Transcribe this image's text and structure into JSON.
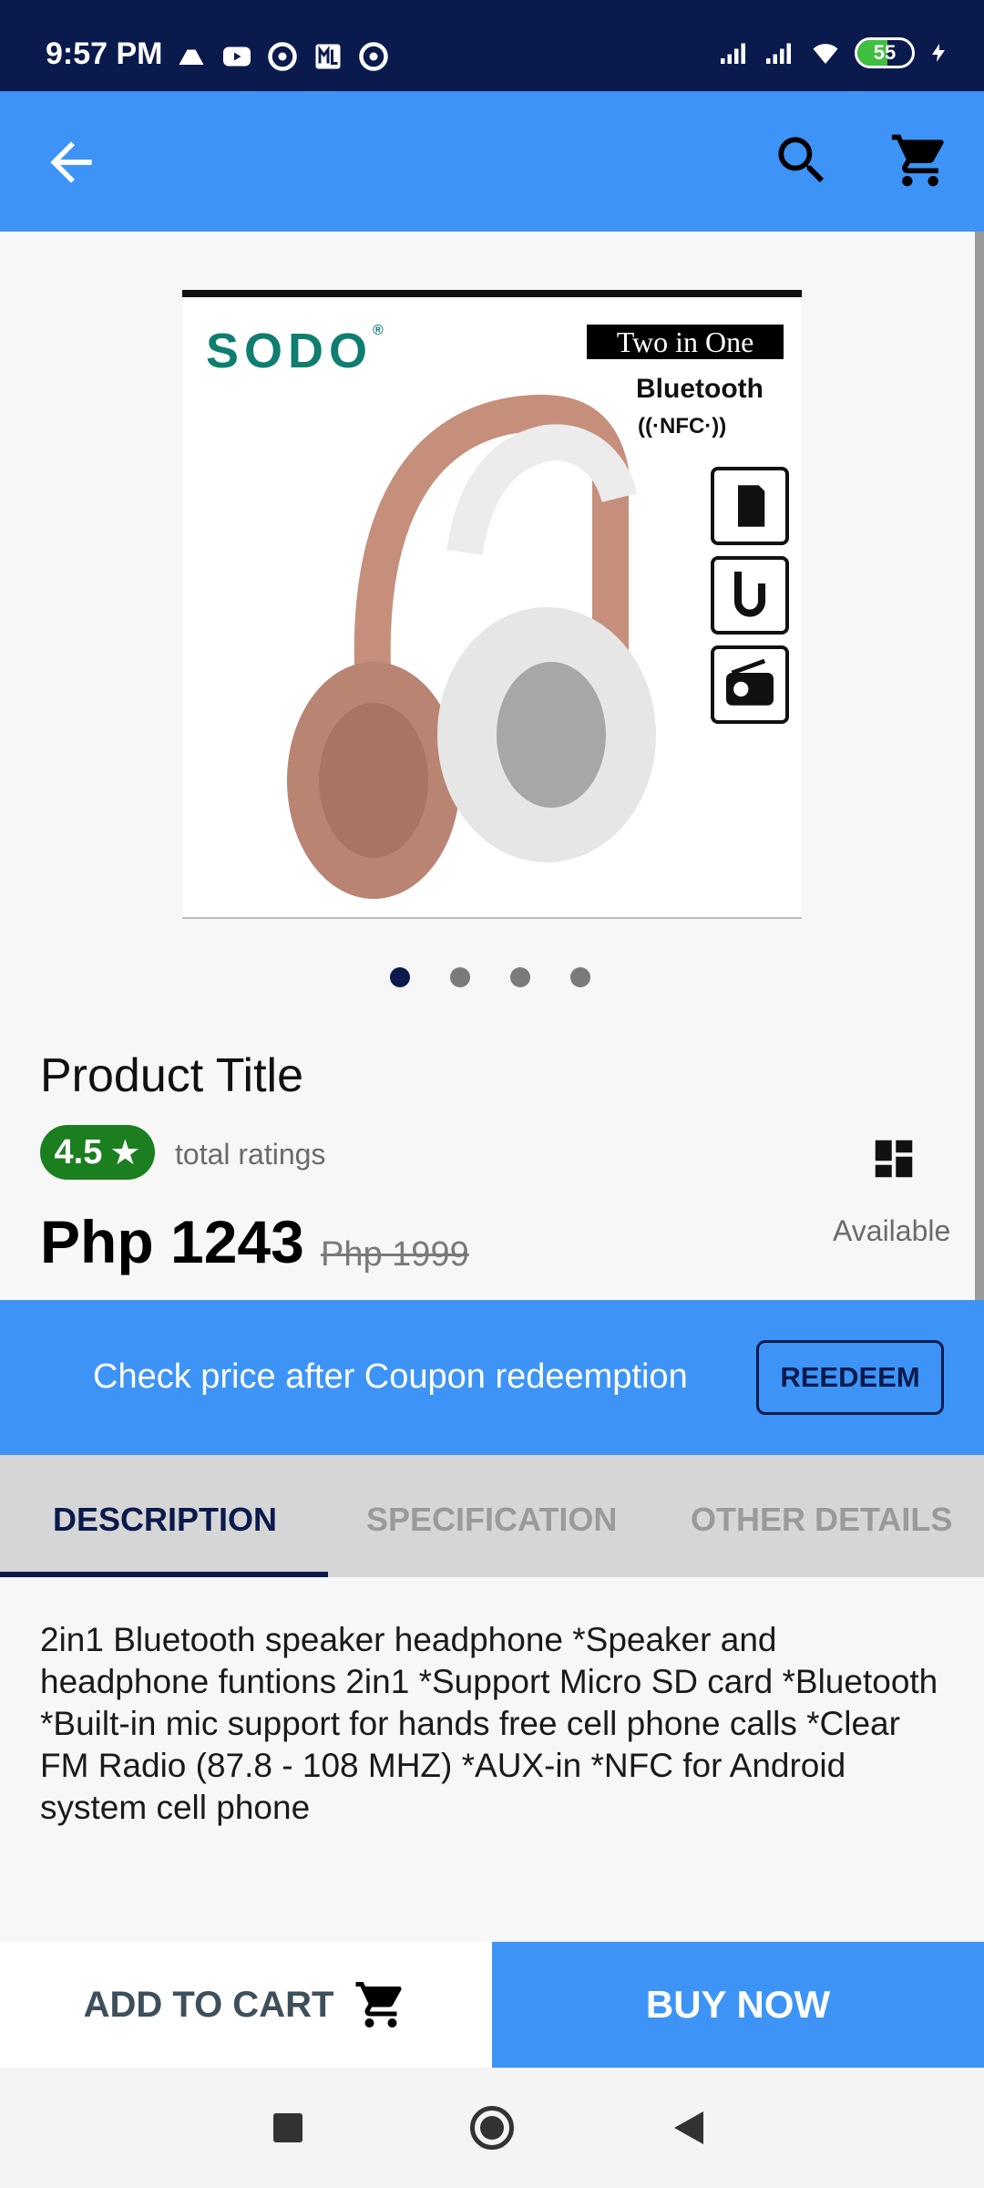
{
  "status_bar": {
    "time": "9:57 PM",
    "battery_level": "55",
    "icons": [
      "drive-icon",
      "youtube-icon",
      "app-icon",
      "ml-icon",
      "app-icon",
      "signal-icon",
      "signal-icon",
      "wifi-icon",
      "battery-icon",
      "charging-icon"
    ]
  },
  "app_bar": {
    "icons": [
      "arrow-left-icon",
      "search-icon",
      "cart-icon"
    ]
  },
  "product_image": {
    "brand": "SODO",
    "promo": "Two in One",
    "bluetooth": "Bluetooth",
    "nfc": "((·NFC·))",
    "feature_icons": [
      "sd-card-icon",
      "aux-cable-icon",
      "radio-icon"
    ]
  },
  "carousel": {
    "count": 4,
    "active_index": 0
  },
  "product": {
    "title": "Product Title",
    "rating": "4.5",
    "rating_star": "★",
    "total_ratings_label": "total ratings",
    "price": "Php 1243",
    "old_price": "Php 1999",
    "availability": "Available"
  },
  "coupon": {
    "text": "Check price after Coupon redeemption",
    "button_label": "REEDEEM"
  },
  "tabs": [
    {
      "label": "DESCRIPTION",
      "active": true
    },
    {
      "label": "SPECIFICATION",
      "active": false
    },
    {
      "label": "OTHER DETAILS",
      "active": false
    }
  ],
  "description": "2in1 Bluetooth speaker headphone *Speaker and headphone funtions 2in1 *Support Micro SD card *Bluetooth *Built-in mic support for hands free cell phone calls *Clear FM Radio (87.8 - 108 MHZ) *AUX-in *NFC for Android system cell phone",
  "actions": {
    "add_to_cart_label": "ADD TO CART",
    "buy_now_label": "BUY NOW"
  },
  "colors": {
    "primary": "#3d94f6",
    "dark": "#0b1a4d",
    "rating_green": "#1b7f20"
  }
}
